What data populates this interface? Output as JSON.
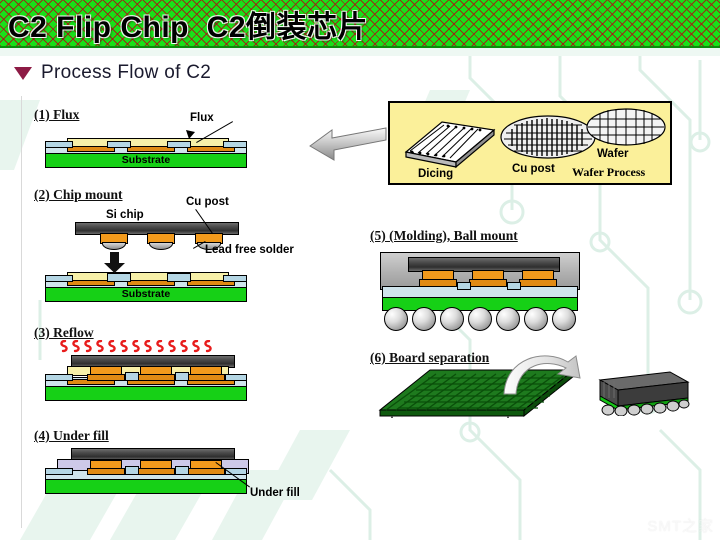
{
  "slide": {
    "title_en": "C2 Flip Chip",
    "title_cn": "C2倒装芯片",
    "section_heading": "Process Flow of C2",
    "bullet_icon": "triangle-down-icon",
    "watermark": "SMT之家"
  },
  "colors": {
    "title_bar_green": "#19E019",
    "title_hatch_red": "#AA1414",
    "bullet_maroon": "#8D1B45",
    "substrate_green": "#16D016",
    "flux_yellow": "#F7F0A8",
    "copper_orange": "#E08A14",
    "cu_post_orange": "#F29A1C",
    "solder_resist_blue": "#CFE4EC",
    "chip_gray": "#4A4A4A",
    "underfill_lavender": "#CDC9E8",
    "wafer_box_yellow": "#FBF09A",
    "heat_red": "#E81C1C",
    "background_circuit": "#DFF1E8"
  },
  "steps": [
    {
      "id": "step-1",
      "label": "(1) Flux",
      "annotations": [
        "Flux"
      ],
      "substrate_text": "Substrate"
    },
    {
      "id": "step-2",
      "label": "(2) Chip mount",
      "annotations": [
        "Si chip",
        "Cu post",
        "Lead free solder"
      ],
      "substrate_text": "Substrate"
    },
    {
      "id": "step-3",
      "label": "(3) Reflow",
      "annotations": [],
      "heat_marks": 13
    },
    {
      "id": "step-4",
      "label": "(4) Under fill",
      "annotations": [
        "Under fill"
      ]
    },
    {
      "id": "step-5",
      "label": "(5) (Molding), Ball mount",
      "annotations": [],
      "ball_count": 7
    },
    {
      "id": "step-6",
      "label": "(6) Board separation",
      "annotations": []
    }
  ],
  "wafer_process": {
    "box_title": "Wafer Process",
    "items": [
      "Dicing",
      "Cu post",
      "Wafer"
    ]
  }
}
